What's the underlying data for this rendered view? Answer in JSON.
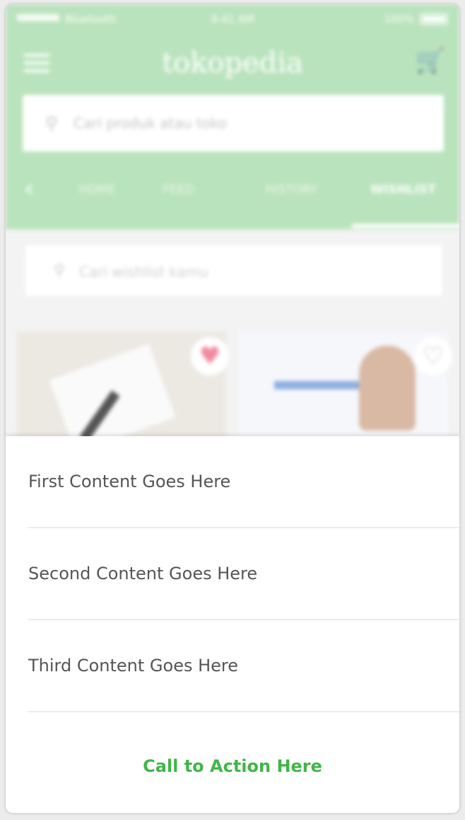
{
  "colors": {
    "brand_green": "#42b549",
    "header_green_dimmed": "#b9e3bc",
    "heart_pink": "#f08aa0"
  },
  "status_bar": {
    "carrier": "Bluetooth",
    "time": "9:41 AM",
    "battery": "100%"
  },
  "header": {
    "logo_text": "tokopedia",
    "menu_icon": "hamburger-icon",
    "cart_icon": "cart-icon"
  },
  "search": {
    "placeholder": "Cari produk atau toko"
  },
  "tabs": [
    "HOME",
    "FEED",
    "HISTORY",
    "WISHLIST"
  ],
  "active_tab": "WISHLIST",
  "wishlist_search": {
    "placeholder": "Cari wishlist kamu"
  },
  "sheet": {
    "items": [
      "First Content Goes Here",
      "Second Content Goes Here",
      "Third Content Goes Here"
    ],
    "cta": "Call to Action Here"
  }
}
